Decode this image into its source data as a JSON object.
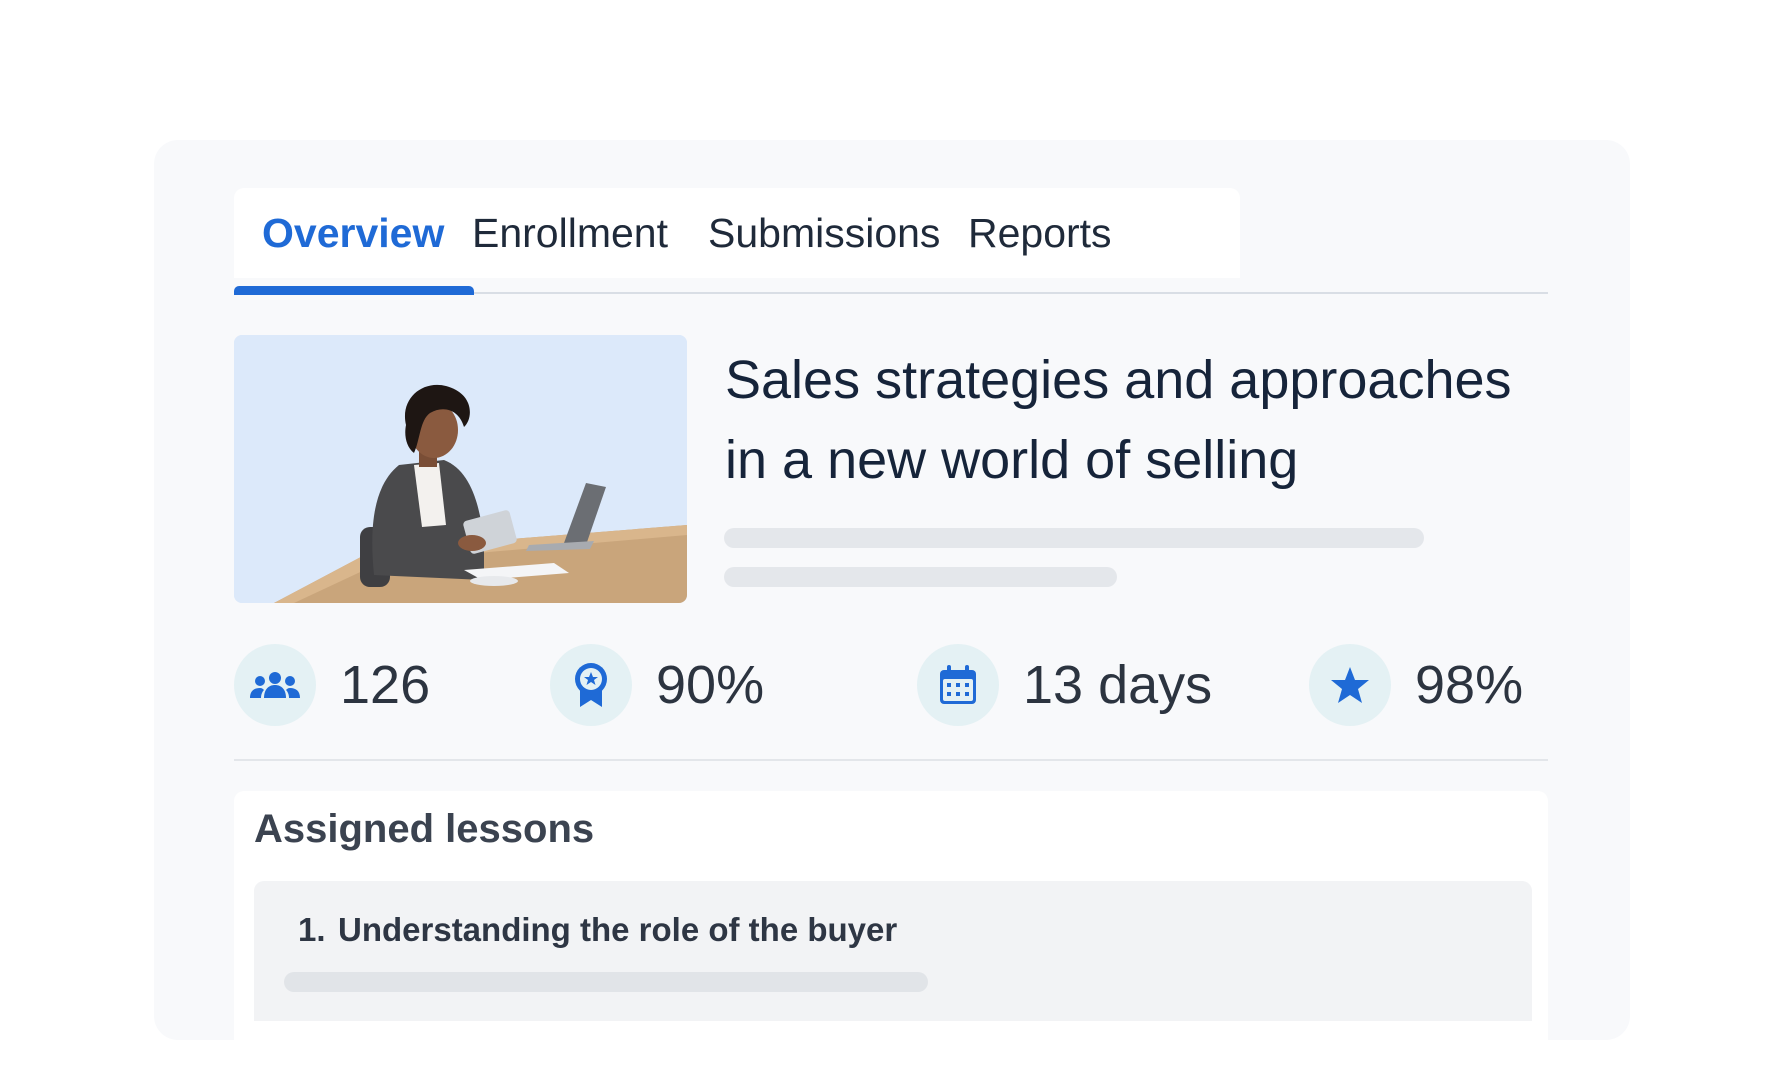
{
  "tabs": [
    {
      "label": "Overview",
      "active": true
    },
    {
      "label": "Enrollment",
      "active": false
    },
    {
      "label": "Submissions",
      "active": false
    },
    {
      "label": "Reports",
      "active": false
    }
  ],
  "course": {
    "title": "Sales strategies and approaches in a new world of selling",
    "image": "woman-working-on-laptop-with-tablet"
  },
  "stats": [
    {
      "icon": "users-icon",
      "value": "126"
    },
    {
      "icon": "award-badge-icon",
      "value": "90%"
    },
    {
      "icon": "calendar-icon",
      "value": "13 days"
    },
    {
      "icon": "star-icon",
      "value": "98%"
    }
  ],
  "lessons": {
    "title": "Assigned lessons",
    "items": [
      {
        "number": "1.",
        "name": "Understanding the role of the buyer"
      }
    ]
  },
  "colors": {
    "accent": "#1f6ad6",
    "icon_bg": "#e4f1f4",
    "image_bg": "#dce9fa"
  }
}
